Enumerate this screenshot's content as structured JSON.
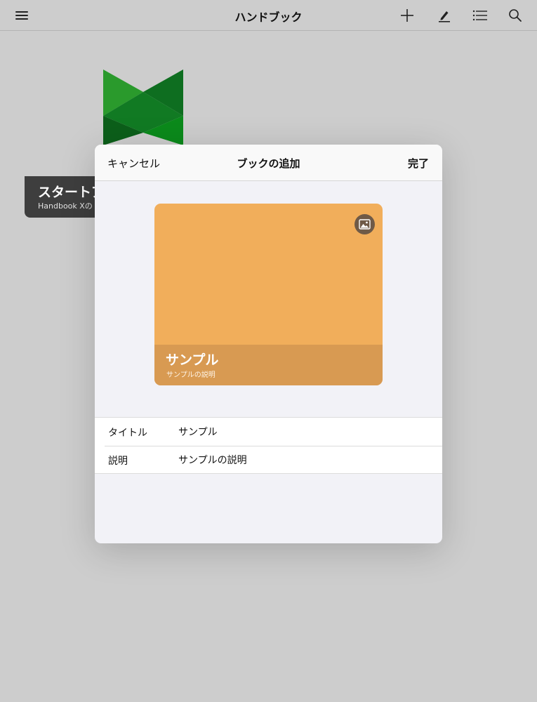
{
  "navbar": {
    "title": "ハンドブック",
    "icons": [
      "menu-icon",
      "plus-icon",
      "pencil-icon",
      "list-icon",
      "search-icon"
    ]
  },
  "background_book": {
    "title": "スタートア",
    "subtitle": "Handbook Xの",
    "logo_colors": [
      "#1f8f2a",
      "#0f6b1f",
      "#0c7a1c"
    ]
  },
  "modal": {
    "cancel_label": "キャンセル",
    "title": "ブックの追加",
    "done_label": "完了",
    "cover": {
      "title": "サンプル",
      "description": "サンプルの説明",
      "color": "#f1ae5b",
      "band_color": "#d89a52",
      "image_button_icon": "image-icon"
    },
    "fields": [
      {
        "label": "タイトル",
        "value": "サンプル"
      },
      {
        "label": "説明",
        "value": "サンプルの説明"
      }
    ]
  }
}
